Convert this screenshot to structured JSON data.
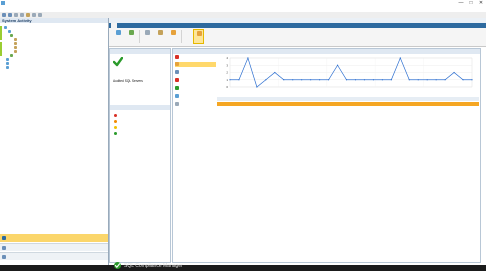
{
  "window": {
    "title": "",
    "buttons": {
      "minimize": "—",
      "maximize": "□",
      "close": "✕"
    }
  },
  "menu": [
    "",
    "",
    "",
    "",
    "",
    "",
    "",
    ""
  ],
  "left": {
    "header": "System Activity",
    "tree": [
      "",
      "",
      "",
      "",
      "",
      "",
      "",
      "",
      "",
      "",
      ""
    ],
    "nav": [
      "",
      "",
      ""
    ]
  },
  "main": {
    "header": "",
    "tabs": [
      "",
      "",
      "",
      ""
    ],
    "ribbon": [
      "",
      "",
      "",
      "",
      "",
      ""
    ],
    "status": {
      "header": "",
      "link": "",
      "rows": [
        {
          "label": "Audited SQL Servers",
          "value": ""
        },
        {
          "label": "",
          "value": ""
        },
        {
          "label": "",
          "value": ""
        },
        {
          "label": "",
          "value": ""
        }
      ]
    },
    "alerts": {
      "header": "",
      "items": [
        {
          "label": "",
          "value": "",
          "color": "#d93025"
        },
        {
          "label": "",
          "value": "",
          "color": "#f28b00"
        },
        {
          "label": "",
          "value": "",
          "color": "#f2c200"
        },
        {
          "label": "",
          "value": "",
          "color": "#2b9b2b"
        }
      ]
    },
    "reports": {
      "header": "",
      "items": [
        "",
        "",
        "",
        "",
        "",
        "",
        ""
      ]
    },
    "chart_caption": "",
    "table": {
      "headers": [
        "",
        "",
        "",
        ""
      ],
      "rows": [
        [
          "",
          "",
          "",
          ""
        ],
        [
          "",
          "",
          "",
          ""
        ],
        [
          "",
          "",
          "",
          ""
        ],
        [
          "",
          "",
          "",
          ""
        ],
        [
          "",
          "",
          "",
          ""
        ],
        [
          "",
          "",
          "",
          ""
        ]
      ]
    }
  },
  "chart_data": {
    "type": "line",
    "title": "",
    "xlabel": "",
    "ylabel": "",
    "x_tick_labels": [
      "",
      "",
      "",
      "",
      "",
      ""
    ],
    "ylim": [
      0,
      4
    ],
    "series": [
      {
        "values": [
          1,
          1,
          4,
          0,
          1,
          2,
          1,
          1,
          1,
          1,
          1,
          1,
          3,
          1,
          1,
          1,
          1,
          1,
          1,
          4,
          1,
          1,
          1,
          1,
          1,
          2,
          1,
          1
        ]
      }
    ],
    "grid": true,
    "legend": "none"
  },
  "statusbar": {
    "product": "SQL Compliance Manager"
  },
  "colors": {
    "accent": "#2d6a9f",
    "success": "#2b9b2b",
    "highlight": "#f5a623"
  }
}
